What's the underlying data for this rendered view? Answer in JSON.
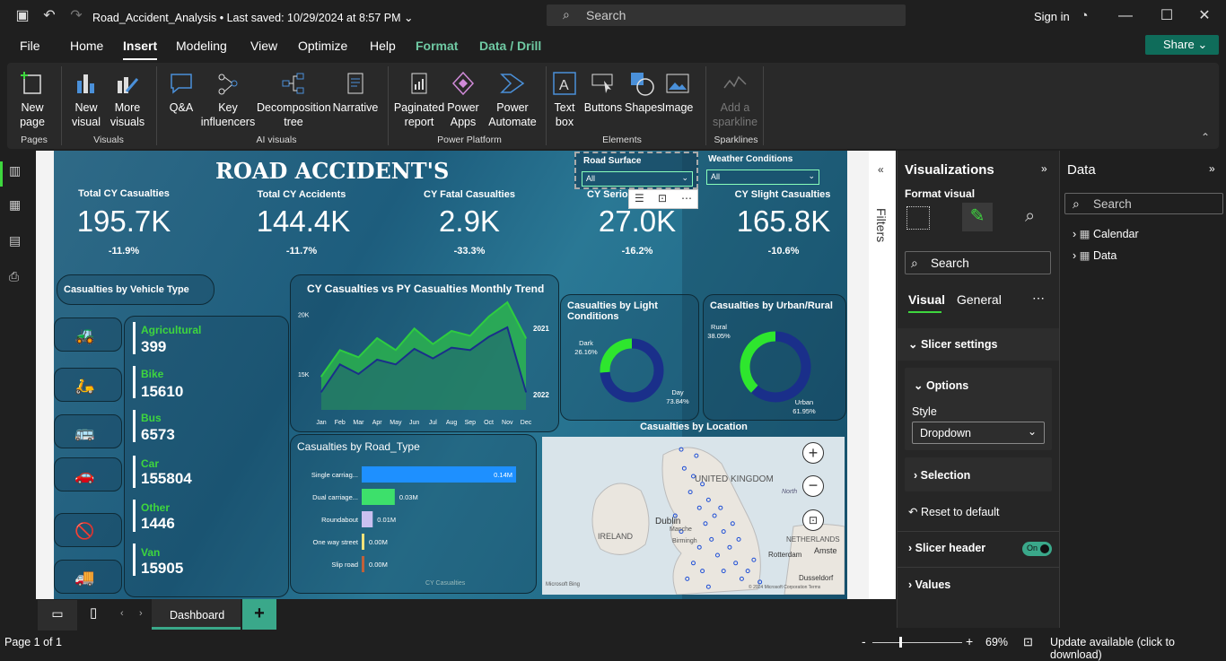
{
  "titlebar": {
    "file_name": "Road_Accident_Analysis",
    "saved": "Last saved: 10/29/2024 at 8:57 PM",
    "search_placeholder": "Search",
    "signin": "Sign in"
  },
  "menu": {
    "items": [
      "File",
      "Home",
      "Insert",
      "Modeling",
      "View",
      "Optimize",
      "Help",
      "Format",
      "Data / Drill"
    ],
    "selected": "Insert",
    "share": "Share"
  },
  "ribbon": {
    "buttons": {
      "new_page": "New page",
      "new_visual": "New visual",
      "more_visuals": "More visuals",
      "qa": "Q&A",
      "key_influencers": "Key influencers",
      "decomposition_tree": "Decomposition tree",
      "narrative": "Narrative",
      "paginated_report": "Paginated report",
      "power_apps": "Power Apps",
      "power_automate": "Power Automate",
      "text_box": "Text box",
      "buttons": "Buttons",
      "shapes": "Shapes",
      "image": "Image",
      "add_sparkline": "Add a sparkline"
    },
    "groups": {
      "pages": "Pages",
      "visuals": "Visuals",
      "ai_visuals": "AI visuals",
      "power_platform": "Power Platform",
      "elements": "Elements",
      "sparklines": "Sparklines"
    }
  },
  "report": {
    "title": "ROAD ACCIDENT'S",
    "kpis": [
      {
        "label": "Total CY Casualties",
        "value": "195.7K",
        "delta": "-11.9%"
      },
      {
        "label": "Total CY Accidents",
        "value": "144.4K",
        "delta": "-11.7%"
      },
      {
        "label": "CY Fatal Casualties",
        "value": "2.9K",
        "delta": "-33.3%"
      },
      {
        "label": "CY Serious Casualties",
        "value": "27.0K",
        "delta": "-16.2%"
      },
      {
        "label": "CY Slight Casualties",
        "value": "165.8K",
        "delta": "-10.6%"
      }
    ],
    "slicers": [
      {
        "label": "Road Surface",
        "value": "All"
      },
      {
        "label": "Weather Conditions",
        "value": "All"
      }
    ],
    "vehicle_title": "Casualties by Vehicle Type",
    "vehicles": [
      {
        "label": "Agricultural",
        "value": "399",
        "icon": "tractor-icon",
        "glyph": "🚜"
      },
      {
        "label": "Bike",
        "value": "15610",
        "icon": "motorbike-icon",
        "glyph": "🛵"
      },
      {
        "label": "Bus",
        "value": "6573",
        "icon": "bus-icon",
        "glyph": "🚌"
      },
      {
        "label": "Car",
        "value": "155804",
        "icon": "car-icon",
        "glyph": "🚗"
      },
      {
        "label": "Other",
        "value": "1446",
        "icon": "prohibited-icon",
        "glyph": "🚫"
      },
      {
        "label": "Van",
        "value": "15905",
        "icon": "van-icon",
        "glyph": "🚚"
      }
    ],
    "trend_title": "CY Casualties vs PY Casualties Monthly Trend",
    "light_title": "Casualties by Light Conditions",
    "urban_title": "Casualties by Urban/Rural",
    "road_title": "Casualties by Road_Type",
    "road_axis": "CY Casualties",
    "map_title": "Casualties by Location",
    "map_labels": {
      "ireland": "IRELAND",
      "dublin": "Dublin",
      "united_kingdom": "UNITED KINGDOM",
      "netherlands": "NETHERLANDS",
      "rotterdam": "Rotterdam",
      "amsterdam": "Amste",
      "dusseldorf": "Dusseldorf",
      "birmingham": "Birmingh",
      "manchester": "Manche",
      "north": "North",
      "bing": "Microsoft Bing",
      "copyright": "© 2024 Microsoft Corporation Terms"
    },
    "map_points": [
      [
        0.47,
        0.2
      ],
      [
        0.5,
        0.25
      ],
      [
        0.53,
        0.3
      ],
      [
        0.49,
        0.35
      ],
      [
        0.55,
        0.4
      ],
      [
        0.52,
        0.45
      ],
      [
        0.57,
        0.5
      ],
      [
        0.54,
        0.55
      ],
      [
        0.6,
        0.6
      ],
      [
        0.56,
        0.65
      ],
      [
        0.62,
        0.7
      ],
      [
        0.58,
        0.75
      ],
      [
        0.64,
        0.8
      ],
      [
        0.6,
        0.85
      ],
      [
        0.66,
        0.9
      ],
      [
        0.52,
        0.7
      ],
      [
        0.5,
        0.8
      ],
      [
        0.48,
        0.9
      ],
      [
        0.55,
        0.95
      ],
      [
        0.68,
        0.85
      ],
      [
        0.7,
        0.78
      ],
      [
        0.63,
        0.55
      ],
      [
        0.46,
        0.6
      ],
      [
        0.44,
        0.5
      ],
      [
        0.59,
        0.45
      ],
      [
        0.51,
        0.12
      ],
      [
        0.46,
        0.08
      ],
      [
        0.65,
        0.65
      ],
      [
        0.53,
        0.85
      ],
      [
        0.72,
        0.92
      ]
    ]
  },
  "chart_data": [
    {
      "type": "area",
      "title": "CY Casualties vs PY Casualties Monthly Trend",
      "x": [
        "Jan",
        "Feb",
        "Mar",
        "Apr",
        "May",
        "Jun",
        "Jul",
        "Aug",
        "Sep",
        "Oct",
        "Nov",
        "Dec"
      ],
      "ylim": [
        12000,
        21000
      ],
      "yticks": [
        "20K",
        "15K"
      ],
      "series": [
        {
          "name": "2021",
          "values": [
            14800,
            17000,
            16400,
            18000,
            17000,
            18800,
            17500,
            18600,
            18200,
            19800,
            21000,
            18000
          ],
          "color": "#2ecc40"
        },
        {
          "name": "2022",
          "values": [
            13500,
            15800,
            15000,
            16200,
            15800,
            17100,
            16300,
            17200,
            17000,
            18100,
            18900,
            13500
          ],
          "color": "#1a2f8a"
        }
      ]
    },
    {
      "type": "pie",
      "title": "Casualties by Light Conditions",
      "categories": [
        "Dark",
        "Day"
      ],
      "values": [
        26.16,
        73.84
      ],
      "labels": [
        "26.16%",
        "73.84%"
      ],
      "colors": [
        "#2ee62e",
        "#1a2f8a"
      ]
    },
    {
      "type": "pie",
      "title": "Casualties by Urban/Rural",
      "categories": [
        "Rural",
        "Urban"
      ],
      "values": [
        38.05,
        61.95
      ],
      "labels": [
        "38.05%",
        "61.95%"
      ],
      "colors": [
        "#2ee62e",
        "#1a2f8a"
      ]
    },
    {
      "type": "bar",
      "title": "Casualties by Road_Type",
      "categories": [
        "Single carriag...",
        "Dual carriage...",
        "Roundabout",
        "One way street",
        "Slip road"
      ],
      "values": [
        0.14,
        0.03,
        0.01,
        0.0,
        0.0
      ],
      "labels": [
        "0.14M",
        "0.03M",
        "0.01M",
        "0.00M",
        "0.00M"
      ],
      "colors": [
        "#1e90ff",
        "#3de06b",
        "#c9c0f0",
        "#f2e27a",
        "#c0603a"
      ],
      "xlabel": "CY Casualties"
    }
  ],
  "filters_label": "Filters",
  "viz": {
    "title": "Visualizations",
    "format_visual": "Format visual",
    "search": "Search",
    "tabs": [
      "Visual",
      "General"
    ],
    "slicer_settings": "Slicer settings",
    "options": "Options",
    "style_label": "Style",
    "style_value": "Dropdown",
    "selection": "Selection",
    "reset": "Reset to default",
    "slicer_header": "Slicer header",
    "toggle": "On",
    "values": "Values"
  },
  "data": {
    "title": "Data",
    "search": "Search",
    "tables": [
      "Calendar",
      "Data"
    ]
  },
  "bottom": {
    "tab": "Dashboard"
  },
  "status": {
    "page": "Page 1 of 1",
    "zoom": "69%",
    "update": "Update available (click to download)"
  },
  "colors": {
    "accent": "#0f6c5a",
    "green": "#3ed63e"
  }
}
